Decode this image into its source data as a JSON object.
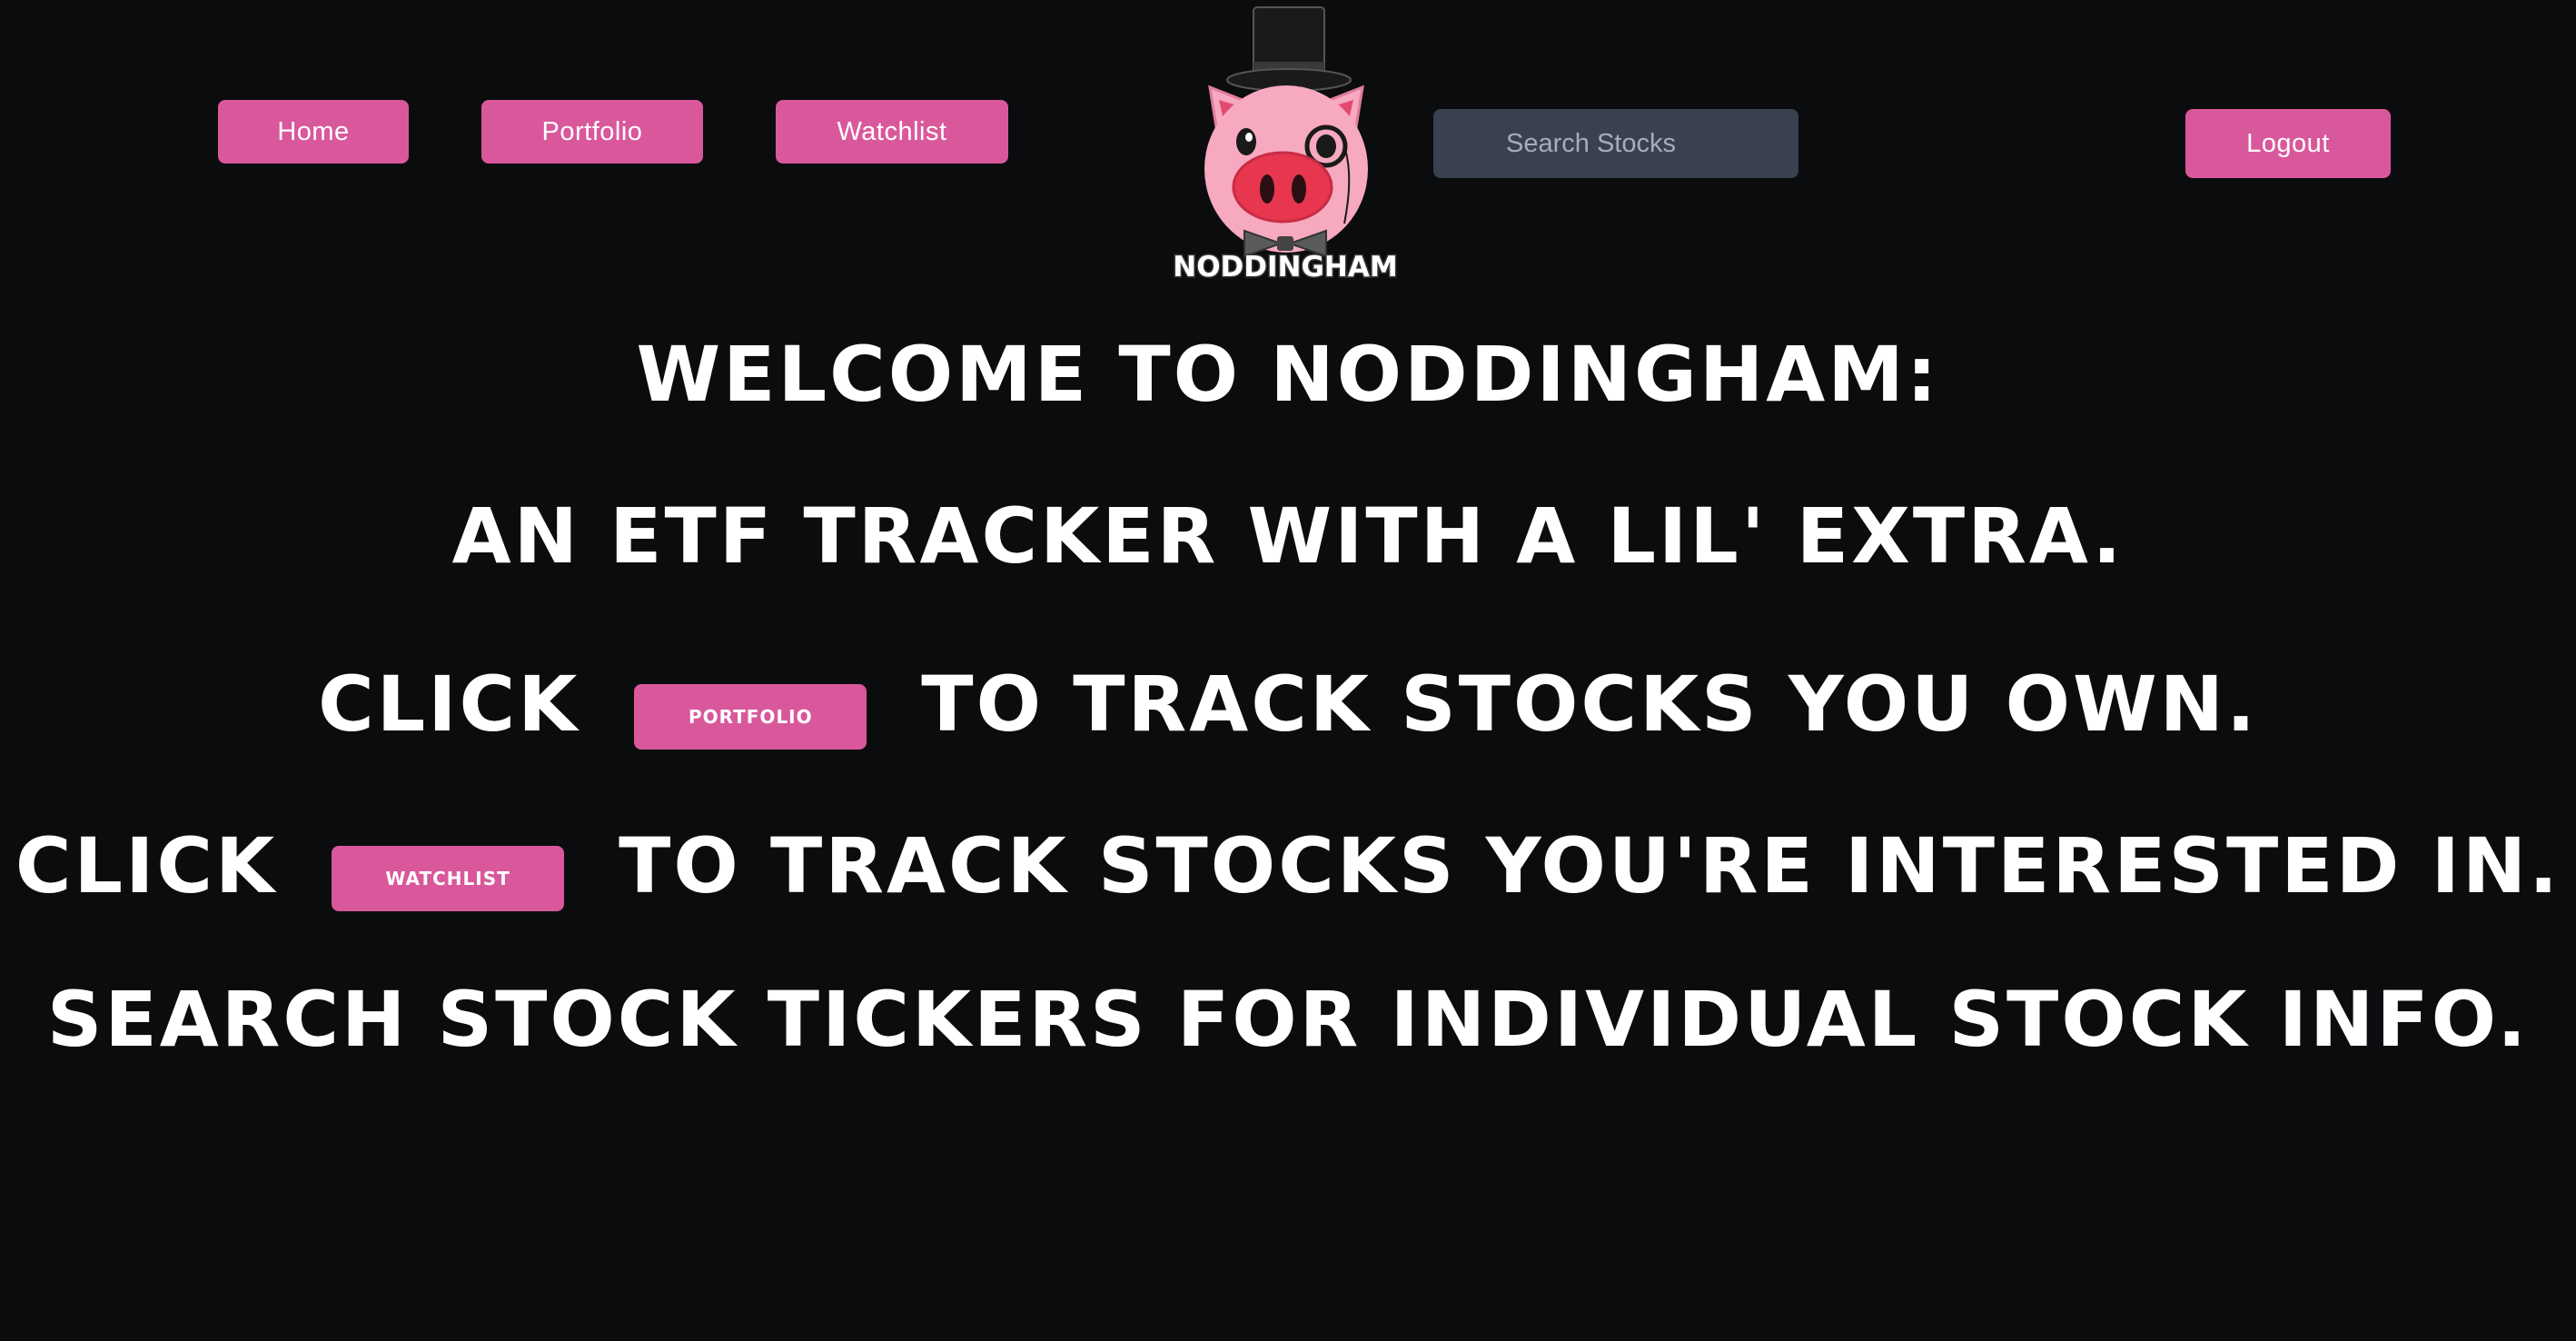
{
  "nav": {
    "home_label": "Home",
    "portfolio_label": "Portfolio",
    "watchlist_label": "Watchlist",
    "logout_label": "Logout"
  },
  "search": {
    "placeholder": "Search Stocks",
    "value": ""
  },
  "logo": {
    "text": "NODDINGHAM",
    "icon": "pig-top-hat-monocle-icon"
  },
  "main": {
    "line1": "WELCOME TO NODDINGHAM:",
    "line2": "AN ETF TRACKER WITH A LIL' EXTRA.",
    "line3_prefix": "CLICK",
    "line3_button": "PORTFOLIO",
    "line3_suffix": "TO TRACK STOCKS YOU OWN.",
    "line4_prefix": "CLICK",
    "line4_button": "WATCHLIST",
    "line4_suffix": "TO TRACK STOCKS YOU'RE INTERESTED IN.",
    "line5": "SEARCH STOCK TICKERS FOR INDIVIDUAL STOCK INFO."
  },
  "colors": {
    "background": "#0b0c0e",
    "accent": "#d9589b",
    "search_bg": "#394150",
    "text": "#ffffff"
  }
}
